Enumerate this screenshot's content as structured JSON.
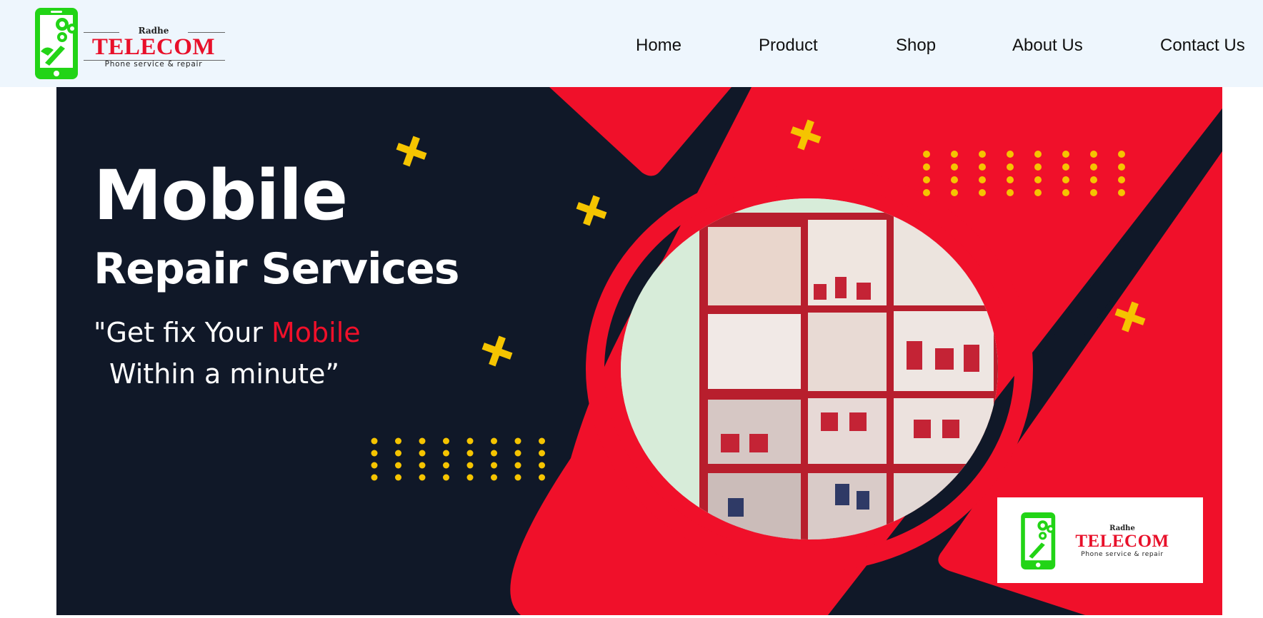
{
  "header": {
    "logo": {
      "small_text": "Radhe",
      "title": "TELECOM",
      "tagline": "Phone service & repair"
    },
    "nav": [
      {
        "label": "Home"
      },
      {
        "label": "Product"
      },
      {
        "label": "Shop"
      },
      {
        "label": "About Us"
      },
      {
        "label": "Contact Us"
      }
    ]
  },
  "banner": {
    "title": "Mobile",
    "subtitle": "Repair Services",
    "quote_line1_white": "\"Get fix Your ",
    "quote_line1_red": "Mobile",
    "quote_line2": "Within a minute”",
    "badge": {
      "small_text": "Radhe",
      "title": "TELECOM",
      "tagline": "Phone service & repair"
    }
  },
  "colors": {
    "header_bg": "#eef6fd",
    "banner_dark": "#101828",
    "accent_red": "#f0102a",
    "accent_yellow": "#f5c400",
    "logo_green": "#22d416"
  },
  "icons": [
    "phone-repair-logo-icon",
    "gear-icon",
    "wrench-icon",
    "plus-decoration-icon"
  ]
}
